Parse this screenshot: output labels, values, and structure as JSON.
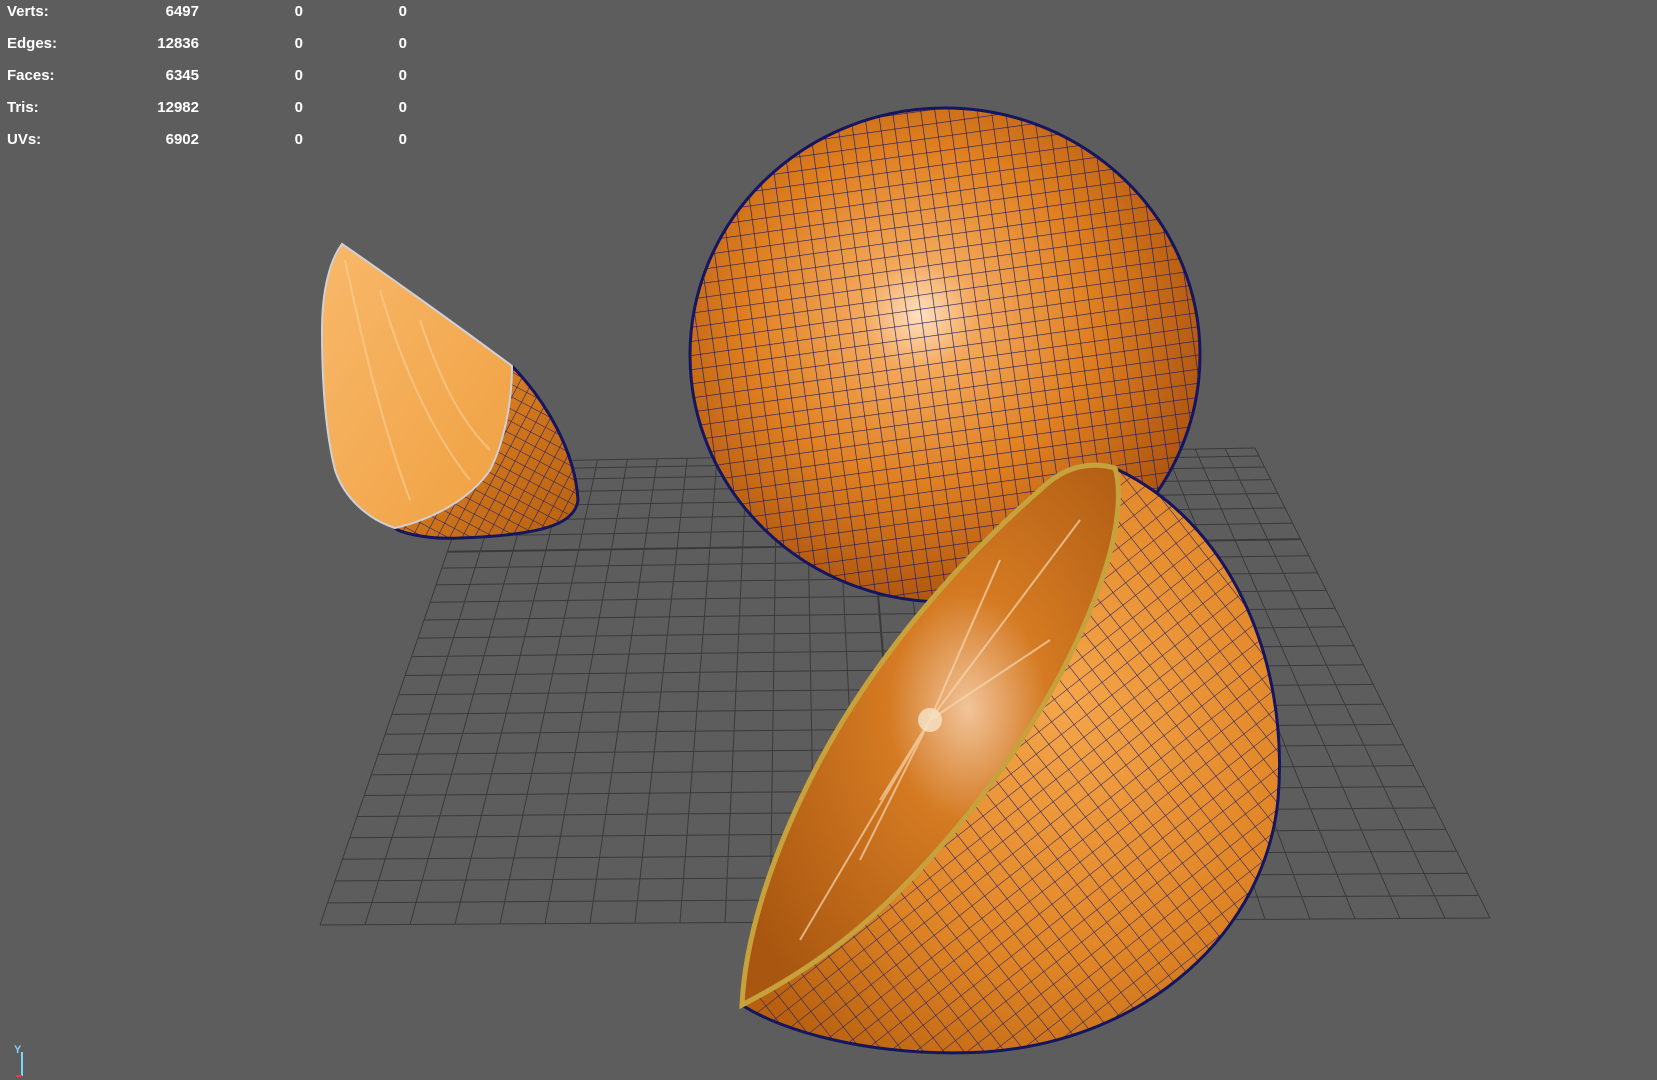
{
  "stats": {
    "rows": [
      {
        "label": "Verts:",
        "v1": "6497",
        "v2": "0",
        "v3": "0"
      },
      {
        "label": "Edges:",
        "v1": "12836",
        "v2": "0",
        "v3": "0"
      },
      {
        "label": "Faces:",
        "v1": "6345",
        "v2": "0",
        "v3": "0"
      },
      {
        "label": "Tris:",
        "v1": "12982",
        "v2": "0",
        "v3": "0"
      },
      {
        "label": "UVs:",
        "v1": "6902",
        "v2": "0",
        "v3": "0"
      }
    ]
  },
  "axis": {
    "y_label": "Y"
  },
  "colors": {
    "background": "#5d5d5d",
    "grid": "#3a3a3a",
    "peel": "#e88a1e",
    "flesh": "#f0a040",
    "wire": "#1a1a6a"
  }
}
